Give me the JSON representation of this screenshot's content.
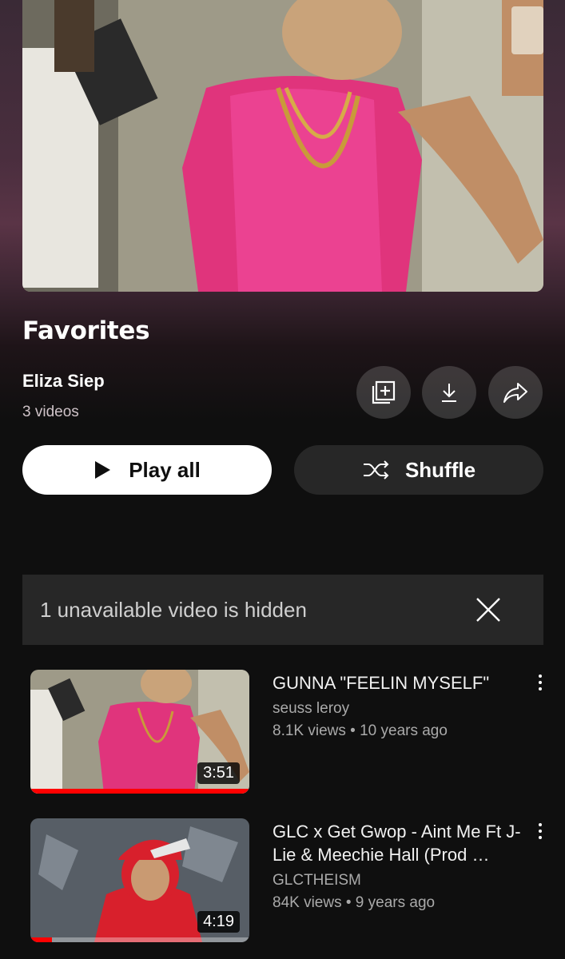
{
  "playlist": {
    "title": "Favorites",
    "owner": "Eliza Siep",
    "video_count": "3 videos"
  },
  "actions": {
    "save_icon": "add-to-library-icon",
    "download_icon": "download-icon",
    "share_icon": "share-icon",
    "play_all_label": "Play all",
    "shuffle_label": "Shuffle"
  },
  "notice": {
    "text": "1 unavailable video is hidden",
    "close_icon": "close-icon"
  },
  "videos": [
    {
      "title": "GUNNA \"FEELIN MYSELF\"",
      "channel": "seuss leroy",
      "meta": "8.1K views • 10 years ago",
      "duration": "3:51",
      "watched_fraction": 1.0
    },
    {
      "title": "GLC x Get Gwop - Aint Me Ft J-Lie & Meechie Hall (Prod …",
      "channel": "GLCTHEISM",
      "meta": "84K views • 9 years ago",
      "duration": "4:19",
      "watched_fraction": 0.1
    }
  ],
  "colors": {
    "progress": "#ff0000",
    "background": "#0f0f0f"
  }
}
